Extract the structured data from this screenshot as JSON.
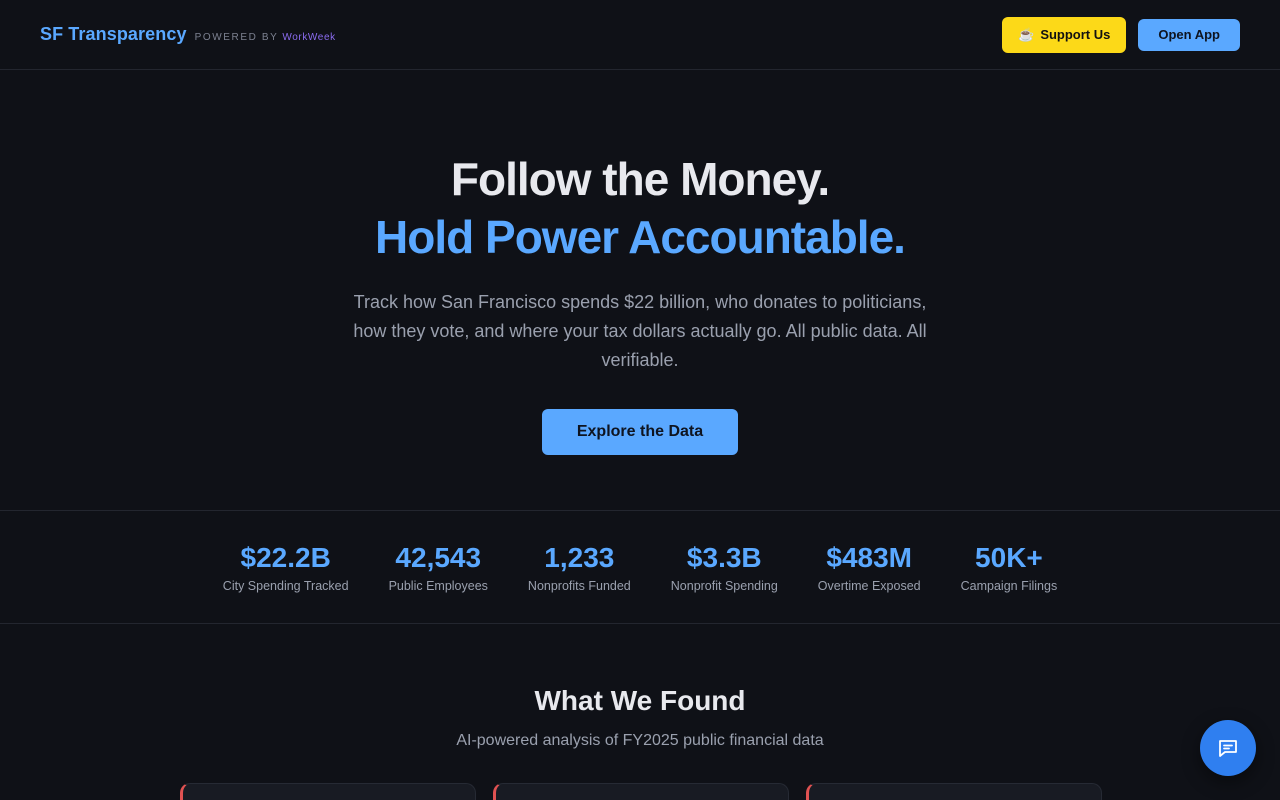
{
  "header": {
    "brand": "SF Transparency",
    "powered_by": "POWERED BY",
    "powered_brand": "WorkWeek",
    "support_icon": "☕",
    "support_label": "Support Us",
    "open_app_label": "Open App"
  },
  "hero": {
    "line1": "Follow the Money.",
    "line2": "Hold Power Accountable.",
    "subtitle": "Track how San Francisco spends $22 billion, who donates to politicians, how they vote, and where your tax dollars actually go. All public data. All verifiable.",
    "cta_label": "Explore the Data"
  },
  "stats": [
    {
      "value": "$22.2B",
      "label": "City Spending Tracked"
    },
    {
      "value": "42,543",
      "label": "Public Employees"
    },
    {
      "value": "1,233",
      "label": "Nonprofits Funded"
    },
    {
      "value": "$3.3B",
      "label": "Nonprofit Spending"
    },
    {
      "value": "$483M",
      "label": "Overtime Exposed"
    },
    {
      "value": "50K+",
      "label": "Campaign Filings"
    }
  ],
  "found": {
    "title": "What We Found",
    "subtitle": "AI-powered analysis of FY2025 public financial data"
  },
  "chat": {
    "icon": "chat-icon"
  },
  "colors": {
    "background": "#0f1117",
    "accent": "#5aa8ff",
    "support": "#fcd918",
    "fab": "#2f7ff0",
    "card_accent": "#e05252"
  }
}
